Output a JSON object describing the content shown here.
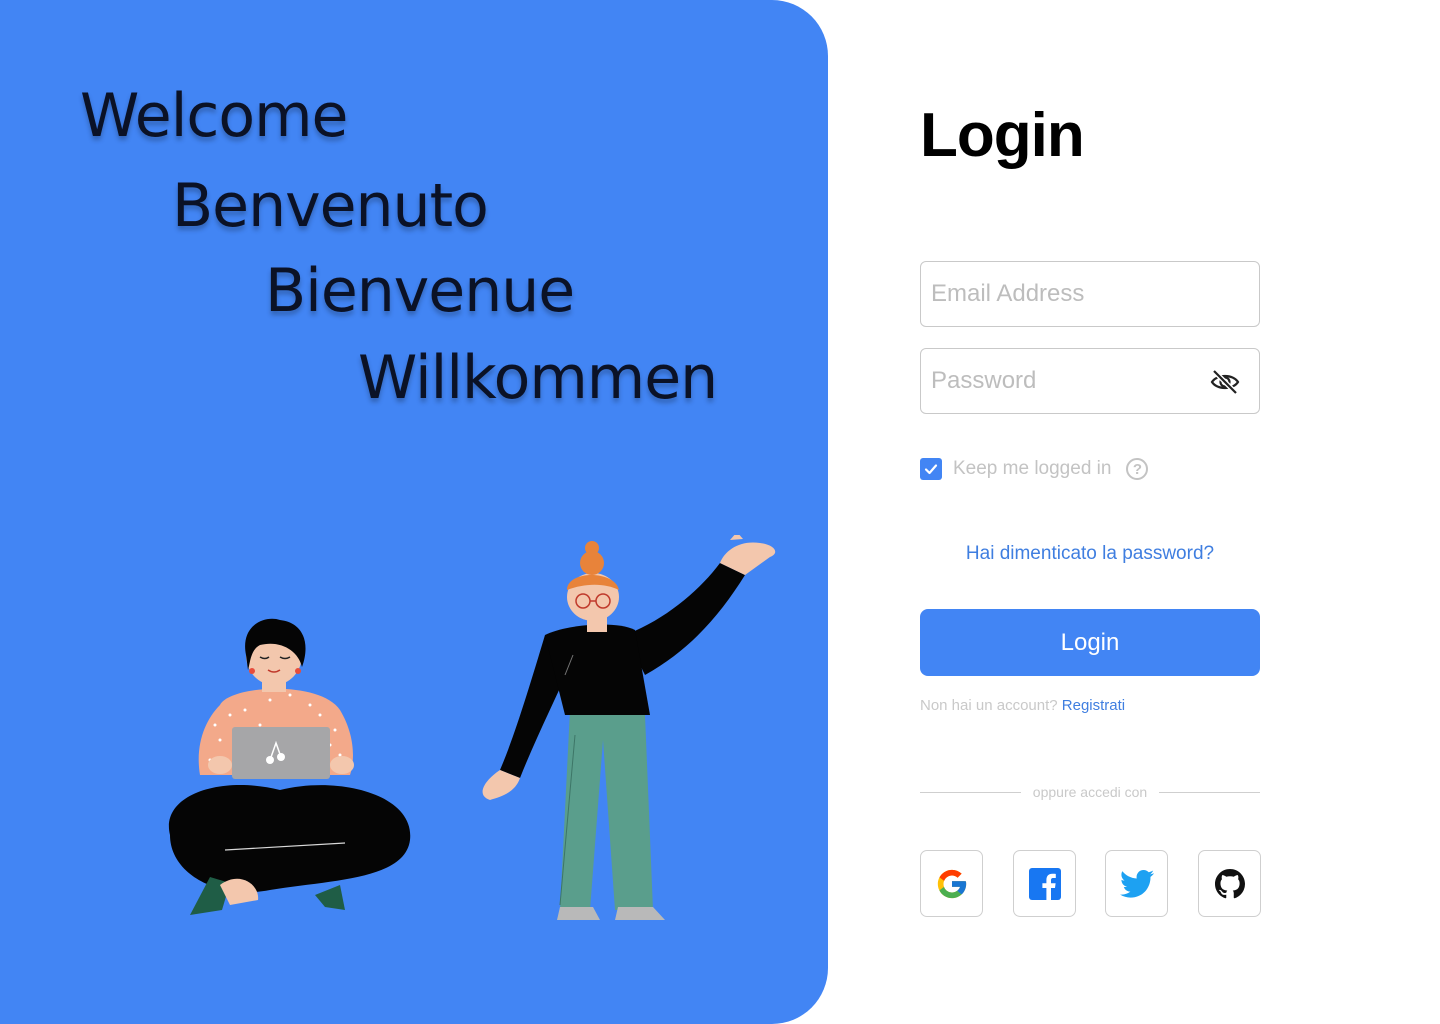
{
  "colors": {
    "brand": "#4285F4",
    "link": "#3f7ee0",
    "placeholder": "#bdbdbd",
    "muted_text": "#c3c3c3"
  },
  "hero": {
    "greetings": [
      "Welcome",
      "Benvenuto",
      "Bienvenue",
      "Willkommen"
    ],
    "illustration": "two-people-illustration"
  },
  "login": {
    "title": "Login",
    "email": {
      "placeholder": "Email Address",
      "value": ""
    },
    "password": {
      "placeholder": "Password",
      "value": "",
      "toggle_icon": "eye-off-icon"
    },
    "keep_logged_in": {
      "label": "Keep me logged in",
      "checked": true,
      "help_icon": "question-icon"
    },
    "forgot_password": "Hai dimenticato la password?",
    "submit_label": "Login",
    "signup_prompt": "Non hai un account?",
    "signup_link": "Registrati",
    "divider_text": "oppure accedi con",
    "social": [
      {
        "provider": "google",
        "icon": "google-icon"
      },
      {
        "provider": "facebook",
        "icon": "facebook-icon"
      },
      {
        "provider": "twitter",
        "icon": "twitter-icon"
      },
      {
        "provider": "github",
        "icon": "github-icon"
      }
    ]
  }
}
